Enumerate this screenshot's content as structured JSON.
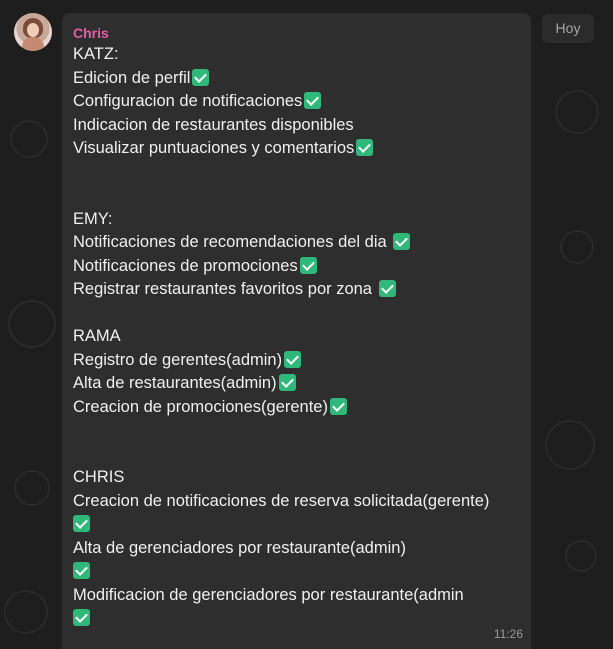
{
  "chat": {
    "date_chip": "Hoy",
    "message": {
      "sender": "Chris",
      "sender_color": "#e15ea3",
      "check_icon": "check-mark-button-emoji",
      "lines": {
        "l0": "KATZ:",
        "l1": "Edicion de perfil",
        "l2": "Configuracion de notificaciones",
        "l3": "Indicacion de restaurantes disponibles",
        "l4": "Visualizar puntuaciones y comentarios",
        "l7": "EMY:",
        "l8": "Notificaciones de recomendaciones del dia",
        "l9": "Notificaciones de promociones",
        "l10": "Registrar restaurantes favoritos por zona",
        "l12": "RAMA",
        "l13": "Registro de gerentes(admin)",
        "l14": "Alta de restaurantes(admin)",
        "l15": "Creacion de promociones(gerente)",
        "l18": "CHRIS",
        "l19": "Creacion de notificaciones de reserva solicitada(gerente)",
        "l21": "Alta de gerenciadores por restaurante(admin)",
        "l23": "Modificacion de gerenciadores por restaurante(admin"
      },
      "time": "11:26"
    }
  }
}
